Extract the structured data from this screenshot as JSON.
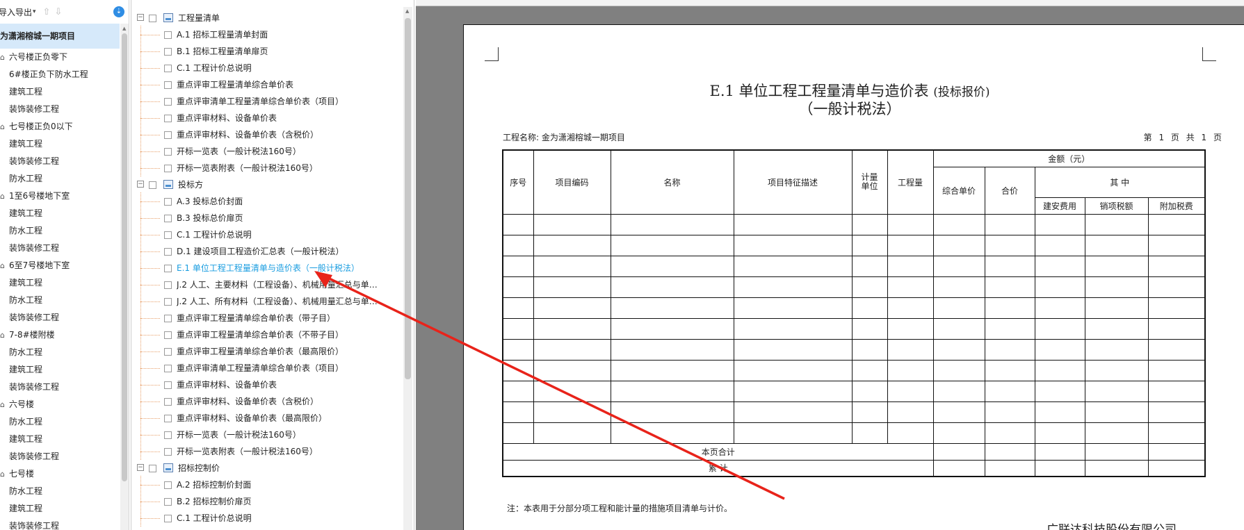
{
  "project_panel": {
    "toolbar_label": "导入导出",
    "root": "为潇湘榕城一期项目",
    "items": [
      {
        "type": "grp",
        "label": "六号楼正负零下"
      },
      {
        "type": "sub",
        "label": "6#楼正负下防水工程"
      },
      {
        "type": "sub",
        "label": "建筑工程"
      },
      {
        "type": "sub",
        "label": "装饰装修工程"
      },
      {
        "type": "grp",
        "label": "七号楼正负0以下"
      },
      {
        "type": "sub",
        "label": "建筑工程"
      },
      {
        "type": "sub",
        "label": "装饰装修工程"
      },
      {
        "type": "sub",
        "label": "防水工程"
      },
      {
        "type": "grp",
        "label": "1至6号楼地下室"
      },
      {
        "type": "sub",
        "label": "建筑工程"
      },
      {
        "type": "sub",
        "label": "防水工程"
      },
      {
        "type": "sub",
        "label": "装饰装修工程"
      },
      {
        "type": "grp",
        "label": "6至7号楼地下室"
      },
      {
        "type": "sub",
        "label": "建筑工程"
      },
      {
        "type": "sub",
        "label": "防水工程"
      },
      {
        "type": "sub",
        "label": "装饰装修工程"
      },
      {
        "type": "grp",
        "label": "7-8#楼附楼"
      },
      {
        "type": "sub",
        "label": "防水工程"
      },
      {
        "type": "sub",
        "label": "建筑工程"
      },
      {
        "type": "sub",
        "label": "装饰装修工程"
      },
      {
        "type": "grp",
        "label": "六号楼"
      },
      {
        "type": "sub",
        "label": "防水工程"
      },
      {
        "type": "sub",
        "label": "建筑工程"
      },
      {
        "type": "sub",
        "label": "装饰装修工程"
      },
      {
        "type": "grp",
        "label": "七号楼"
      },
      {
        "type": "sub",
        "label": "防水工程"
      },
      {
        "type": "sub",
        "label": "建筑工程"
      },
      {
        "type": "sub",
        "label": "装饰装修工程"
      }
    ]
  },
  "report_tree": {
    "rows": [
      {
        "type": "grp",
        "label": "工程量清单",
        "exp": "⊟"
      },
      {
        "type": "leaf",
        "label": "A.1 招标工程量清单封面"
      },
      {
        "type": "leaf",
        "label": "B.1 招标工程量清单扉页"
      },
      {
        "type": "leaf",
        "label": "C.1 工程计价总说明"
      },
      {
        "type": "leaf",
        "label": "重点评审工程量清单综合单价表"
      },
      {
        "type": "leaf",
        "label": "重点评审清单工程量清单综合单价表（项目）"
      },
      {
        "type": "leaf",
        "label": "重点评审材料、设备单价表"
      },
      {
        "type": "leaf",
        "label": "重点评审材料、设备单价表（含税价）"
      },
      {
        "type": "leaf",
        "label": "开标一览表（一般计税法160号）"
      },
      {
        "type": "leaf",
        "label": "开标一览表附表（一般计税法160号）"
      },
      {
        "type": "grp",
        "label": "投标方",
        "exp": "⊟"
      },
      {
        "type": "leaf",
        "label": "A.3 投标总价封面"
      },
      {
        "type": "leaf",
        "label": "B.3 投标总价扉页"
      },
      {
        "type": "leaf",
        "label": "C.1 工程计价总说明"
      },
      {
        "type": "leaf",
        "label": "D.1 建设项目工程造价汇总表（一般计税法）"
      },
      {
        "type": "leaf",
        "label": "E.1 单位工程工程量清单与造价表（一般计税法）",
        "active": true
      },
      {
        "type": "leaf",
        "label": "J.2 人工、主要材料（工程设备）、机械用量汇总与单…"
      },
      {
        "type": "leaf",
        "label": "J.2 人工、所有材料（工程设备）、机械用量汇总与单…"
      },
      {
        "type": "leaf",
        "label": "重点评审工程量清单综合单价表（带子目）"
      },
      {
        "type": "leaf",
        "label": "重点评审工程量清单综合单价表（不带子目）"
      },
      {
        "type": "leaf",
        "label": "重点评审工程量清单综合单价表（最高限价）"
      },
      {
        "type": "leaf",
        "label": "重点评审清单工程量清单综合单价表（项目）"
      },
      {
        "type": "leaf",
        "label": "重点评审材料、设备单价表"
      },
      {
        "type": "leaf",
        "label": "重点评审材料、设备单价表（含税价）"
      },
      {
        "type": "leaf",
        "label": "重点评审材料、设备单价表（最高限价）"
      },
      {
        "type": "leaf",
        "label": "开标一览表（一般计税法160号）"
      },
      {
        "type": "leaf",
        "label": "开标一览表附表（一般计税法160号）"
      },
      {
        "type": "grp",
        "label": "招标控制价",
        "exp": "⊟"
      },
      {
        "type": "leaf",
        "label": "A.2 招标控制价封面"
      },
      {
        "type": "leaf",
        "label": "B.2 招标控制价扉页"
      },
      {
        "type": "leaf",
        "label": "C.1 工程计价总说明"
      }
    ]
  },
  "document": {
    "title_main": "E.1 单位工程工程量清单与造价表",
    "title_paren": "(投标报价)",
    "subtitle": "（一般计税法）",
    "project_name": "工程名称: 金为潇湘榕城一期项目",
    "page_no": "第 1 页 共 1 页",
    "headers": {
      "seq": "序号",
      "code": "项目编码",
      "name": "名称",
      "feature": "项目特征描述",
      "unit": "计量单位",
      "qty": "工程量",
      "amount": "金额（元）",
      "unit_price": "综合单价",
      "total": "合价",
      "of_which": "其  中",
      "install_fee": "建安费用",
      "output_tax": "销项税额",
      "extra_tax": "附加税费"
    },
    "empty_rows": 11,
    "sum_page": "本页合计",
    "sum_total": "累    计",
    "note": "注：本表用于分部分项工程和能计量的措施项目清单与计价。",
    "company": "广联达科技股份有限公司"
  },
  "colors": {
    "arrow": "#e8231a",
    "selection_bg": "#d6e9fa",
    "active_text": "#1a9de0",
    "preview_bg": "#808080"
  }
}
